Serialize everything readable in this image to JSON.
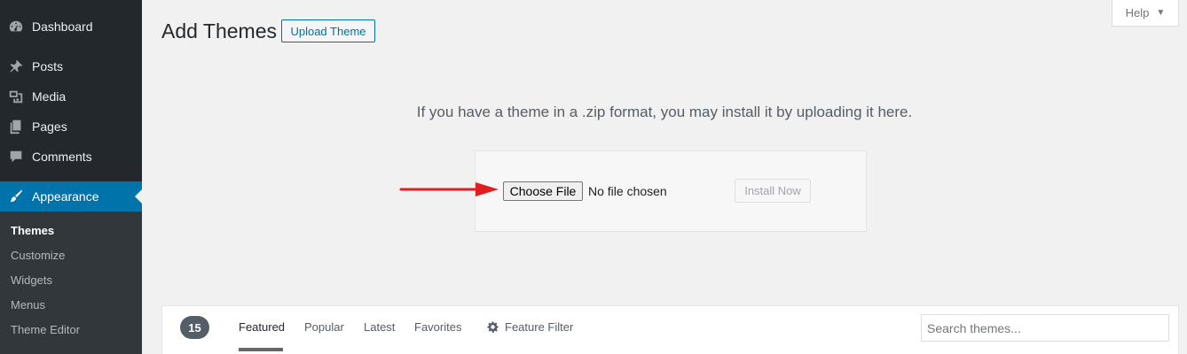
{
  "sidebar": {
    "items": [
      {
        "label": "Dashboard",
        "icon": "dashboard-icon"
      },
      {
        "label": "Posts",
        "icon": "pin-icon"
      },
      {
        "label": "Media",
        "icon": "media-icon"
      },
      {
        "label": "Pages",
        "icon": "pages-icon"
      },
      {
        "label": "Comments",
        "icon": "comment-icon"
      },
      {
        "label": "Appearance",
        "icon": "brush-icon"
      }
    ],
    "submenu": [
      "Themes",
      "Customize",
      "Widgets",
      "Menus",
      "Theme Editor"
    ],
    "current_submenu": "Themes"
  },
  "header": {
    "title": "Add Themes",
    "upload_button": "Upload Theme",
    "help_label": "Help",
    "help_caret": "▼"
  },
  "upload": {
    "message": "If you have a theme in a .zip format, you may install it by uploading it here.",
    "choose_file": "Choose File",
    "no_file": "No file chosen",
    "install_button": "Install Now"
  },
  "filter_bar": {
    "count": "15",
    "tabs": [
      "Featured",
      "Popular",
      "Latest",
      "Favorites"
    ],
    "current_tab": "Featured",
    "feature_filter": "Feature Filter",
    "search_placeholder": "Search themes..."
  },
  "colors": {
    "sidebar_bg": "#23282d",
    "accent": "#0073aa",
    "arrow": "#e02020"
  }
}
